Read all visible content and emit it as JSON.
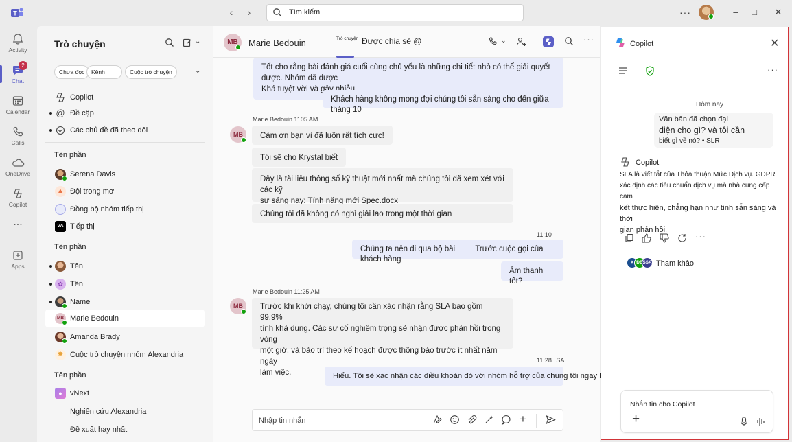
{
  "titlebar": {
    "search_placeholder": "Tìm kiếm"
  },
  "rail": {
    "items": [
      {
        "label": "Activity",
        "icon": "bell-icon"
      },
      {
        "label": "Chat",
        "icon": "chat-icon",
        "badge": "2"
      },
      {
        "label": "Calendar",
        "icon": "calendar-icon"
      },
      {
        "label": "Calls",
        "icon": "phone-icon"
      },
      {
        "label": "OneDrive",
        "icon": "cloud-icon"
      },
      {
        "label": "Copilot",
        "icon": "copilot-icon"
      },
      {
        "label": "Apps",
        "icon": "apps-icon"
      }
    ],
    "more": "..."
  },
  "chatlist": {
    "title": "Trò chuyện",
    "filters": [
      "Chưa đọc",
      "Kênh",
      "Cuộc trò chuyện"
    ],
    "top_items": [
      {
        "label": "Copilot"
      },
      {
        "label": "Đề cập"
      },
      {
        "label": "Các chủ đề đã theo dõi"
      }
    ],
    "sections": [
      {
        "title": "Tên phần",
        "items": [
          {
            "label": "Serena Davis"
          },
          {
            "label": "Đội trong mơ"
          },
          {
            "label": "Đồng bộ nhóm tiếp thị"
          },
          {
            "label": "Tiếp thị",
            "logo_text": "VA"
          }
        ]
      },
      {
        "title": "Tên phần",
        "items": [
          {
            "label": "Tên"
          },
          {
            "label": "Tên"
          },
          {
            "label": "Name"
          },
          {
            "label": "Marie Bedouin",
            "initials": "MB"
          },
          {
            "label": "Amanda Brady"
          },
          {
            "label": "Cuộc trò chuyện nhóm Alexandria"
          }
        ]
      },
      {
        "title": "Tên phần",
        "items": [
          {
            "label": "vNext"
          },
          {
            "label": "Nghiên cứu Alexandria"
          },
          {
            "label": "Đề xuất hay nhất"
          }
        ]
      }
    ]
  },
  "conversation": {
    "name": "Marie Bedouin",
    "initials": "MB",
    "tab_small": "Trò chuyện",
    "tab_shared": "Được chia sẻ @",
    "messages": {
      "m1_line1": "Tốt cho rằng bài đánh giá cuối cùng chủ yếu là những chi tiết nhỏ có thể giải quyết được. Nhóm đã được",
      "m1_line2": "Khá tuyệt vời và gây nhiễu.",
      "m2": "Khách hàng không mong đợi chúng tôi sẵn sàng cho đến giữa tháng 10",
      "meta1": "Marie Bedouin 1105 AM",
      "t1": "Cảm ơn bạn vì đã luôn rất tích cực!",
      "t2": "Tôi sẽ cho Krystal biết",
      "t3_line1": "Đây là tài liệu thông số kỹ thuật mới nhất mà chúng tôi đã xem xét với các kỹ",
      "t3_line2": "sư sáng nay: Tính năng mới Spec.docx",
      "t4": "Chúng tôi đã không có nghỉ giải lao trong một thời gian",
      "time2": "11:10",
      "me3a": "Chúng ta nên đi qua bộ bài",
      "me3b": "Trước cuộc gọi của khách hàng",
      "me4": "Âm thanh tốt?",
      "meta2": "Marie Bedouin 11:25 AM",
      "t5_line1": "Trước khi khởi chạy, chúng tôi cần xác nhận rằng SLA bao gồm 99,9%",
      "t5_line2": "tính khả dụng. Các sự cố nghiêm trọng sẽ nhận được phản hồi trong vòng",
      "t5_line3": "một giờ. và bảo trì theo kế hoạch được thông báo trước ít nhất năm ngày",
      "t5_line4": "làm việc.",
      "time3": "11:28",
      "time3_suffix": "SA",
      "me5": "Hiểu. Tôi sẽ xác nhận các điều khoản đó với nhóm hỗ trợ của chúng tôi ngay hôm nay ."
    },
    "compose_placeholder": "Nhập tin nhắn"
  },
  "copilot": {
    "title": "Copilot",
    "date": "Hôm nay",
    "user_msg_line1": "Văn bản đã chọn đại",
    "user_msg_line2": "diện cho gì? và tôi cần",
    "user_msg_line3": "biết gì về nó? • SLR",
    "answer_head": "Copilot",
    "answer_line1": "SLA là viết tắt của Thỏa thuận Mức Dịch vụ. GDPR",
    "answer_line2": "xác định các tiêu chuẩn dịch vụ mà nhà cung cấp cam",
    "answer_line3": "kết thực hiện, chẳng hạn như tính sẵn sàng và thời",
    "answer_line4": "gian phản hồi.",
    "ref_label": "Tham khảo",
    "ref_badges": [
      "X",
      "ĐB",
      "SSA"
    ],
    "input_placeholder": "Nhắn tin cho Copilot"
  },
  "colors": {
    "accent": "#5b5fc7",
    "my_bubble": "#e8ebfa",
    "their_bubble": "#f0f0f0",
    "presence": "#13a10e",
    "badge": "#c4314b",
    "panel_border": "#d13438"
  }
}
